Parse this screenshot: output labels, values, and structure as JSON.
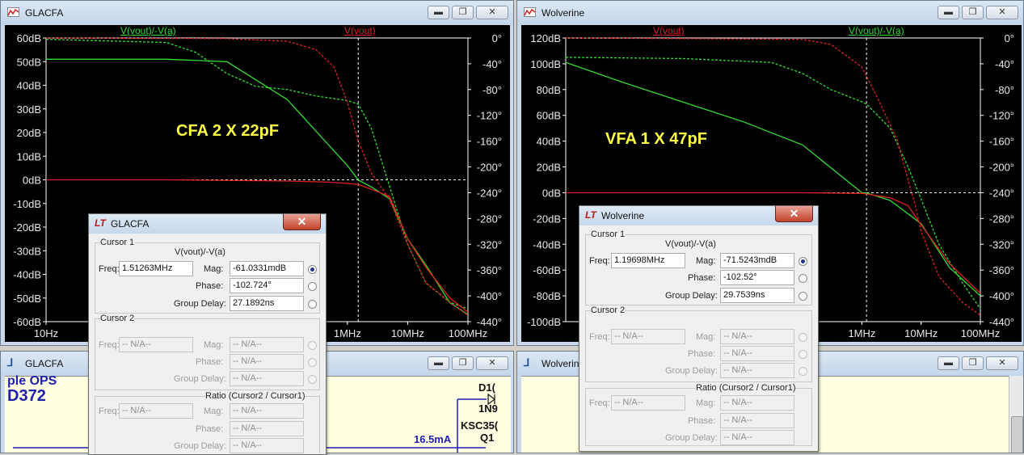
{
  "plots": [
    {
      "window_title": "GLACFA",
      "annotation": "CFA 2 X 22pF",
      "legend": {
        "green": "V(vout)/-V(a)",
        "red": "V(vout)"
      },
      "left_ticks": [
        "60dB",
        "50dB",
        "40dB",
        "30dB",
        "20dB",
        "10dB",
        "0dB",
        "-10dB",
        "-20dB",
        "-30dB",
        "-40dB",
        "-50dB",
        "-60dB"
      ],
      "right_ticks": [
        "0°",
        "-40°",
        "-80°",
        "-120°",
        "-160°",
        "-200°",
        "-240°",
        "-280°",
        "-320°",
        "-360°",
        "-400°",
        "-440°"
      ],
      "x_ticks_visible": [
        "10Hz",
        "1MHz",
        "10MHz",
        "100MHz"
      ],
      "chart_data": {
        "type": "line",
        "title": "",
        "xlabel": "",
        "ylabel": "",
        "x_scale": "log",
        "xlim": [
          "10Hz",
          "100MHz"
        ],
        "ylim_left_dB": [
          -60,
          60
        ],
        "ylim_right_deg": [
          -440,
          0
        ],
        "cursor_x": "1.51263MHz",
        "series": [
          {
            "name": "V(vout)/-V(a)",
            "trace": "magnitude",
            "color": "#33dd33",
            "x": [
              10,
              1000,
              10000,
              100000,
              1000000,
              1512630,
              2500000,
              5000000,
              10000000,
              20000000,
              50000000,
              100000000
            ],
            "y_dB": [
              51,
              51,
              50,
              34,
              6,
              -0.06,
              -3,
              -8,
              -25,
              -36,
              -52,
              -57
            ]
          },
          {
            "name": "V(vout)/-V(a)",
            "trace": "phase",
            "color": "#33dd33",
            "x": [
              10,
              1000,
              3000,
              10000,
              30000,
              100000,
              300000,
              1000000,
              1512630,
              2500000,
              5000000,
              10000000,
              20000000,
              50000000,
              100000000
            ],
            "y_deg": [
              -2,
              -7,
              -22,
              -55,
              -75,
              -80,
              -90,
              -97,
              -102.7,
              -140,
              -230,
              -320,
              -380,
              -410,
              -420
            ]
          },
          {
            "name": "V(vout)",
            "trace": "magnitude",
            "color": "#e02020",
            "x": [
              10,
              1000,
              100000,
              500000,
              1000000,
              1512630,
              2500000,
              5000000,
              10000000,
              20000000,
              50000000,
              100000000
            ],
            "y_dB": [
              0,
              0,
              -0.5,
              -1,
              -1.5,
              -2,
              -4,
              -7,
              -25,
              -37,
              -50,
              -56
            ]
          },
          {
            "name": "V(vout)",
            "trace": "phase",
            "color": "#e02020",
            "x": [
              10,
              10000,
              100000,
              300000,
              600000,
              1000000,
              1512630,
              2500000,
              5000000,
              10000000,
              20000000,
              50000000,
              100000000
            ],
            "y_deg": [
              0,
              -1,
              -5,
              -18,
              -45,
              -100,
              -160,
              -210,
              -250,
              -320,
              -380,
              -410,
              -430
            ]
          }
        ]
      }
    },
    {
      "window_title": "Wolverine",
      "annotation": "VFA 1 X 47pF",
      "legend": {
        "green": "V(vout)/-V(a)",
        "red": "V(vout)"
      },
      "left_ticks": [
        "120dB",
        "100dB",
        "80dB",
        "60dB",
        "40dB",
        "20dB",
        "0dB",
        "-20dB",
        "-40dB",
        "-60dB",
        "-80dB",
        "-100dB"
      ],
      "right_ticks": [
        "0°",
        "-40°",
        "-80°",
        "-120°",
        "-160°",
        "-200°",
        "-240°",
        "-280°",
        "-320°",
        "-360°",
        "-400°",
        "-440°"
      ],
      "x_ticks_visible": [
        "1MHz",
        "10MHz",
        "100MHz"
      ],
      "chart_data": {
        "type": "line",
        "title": "",
        "xlabel": "",
        "ylabel": "",
        "x_scale": "log",
        "xlim": [
          "10Hz",
          "100MHz"
        ],
        "ylim_left_dB": [
          -100,
          120
        ],
        "ylim_right_deg": [
          -440,
          0
        ],
        "cursor_x": "1.19698MHz",
        "series": [
          {
            "name": "V(vout)/-V(a)",
            "trace": "magnitude",
            "color": "#33dd33",
            "x": [
              10,
              100,
              1000,
              10000,
              100000,
              1000000,
              1196980,
              3000000,
              10000000,
              30000000,
              100000000
            ],
            "y_dB": [
              101,
              85,
              70,
              55,
              37,
              0,
              -0.07,
              -6,
              -24,
              -58,
              -80
            ]
          },
          {
            "name": "V(vout)/-V(a)",
            "trace": "phase",
            "color": "#33dd33",
            "x": [
              10,
              1000,
              30000,
              100000,
              300000,
              1000000,
              1196980,
              3000000,
              6000000,
              10000000,
              20000000,
              50000000,
              100000000
            ],
            "y_deg": [
              -30,
              -32,
              -38,
              -55,
              -80,
              -99,
              -102.5,
              -140,
              -200,
              -250,
              -320,
              -380,
              -420
            ]
          },
          {
            "name": "V(vout)",
            "trace": "magnitude",
            "color": "#e02020",
            "x": [
              10,
              1000,
              100000,
              1000000,
              1196980,
              3000000,
              6000000,
              10000000,
              30000000,
              100000000
            ],
            "y_dB": [
              0,
              0,
              0,
              -0.5,
              -1,
              -4,
              -10,
              -25,
              -55,
              -78
            ]
          },
          {
            "name": "V(vout)",
            "trace": "phase",
            "color": "#e02020",
            "x": [
              10,
              100000,
              300000,
              1000000,
              2000000,
              4000000,
              6000000,
              8000000,
              10000000,
              20000000,
              50000000,
              100000000
            ],
            "y_deg": [
              0,
              -2,
              -10,
              -45,
              -100,
              -160,
              -220,
              -260,
              -300,
              -370,
              -410,
              -430
            ]
          }
        ]
      }
    }
  ],
  "schematics": [
    {
      "window_title": "GLACFA",
      "texts": [
        "ple OPS",
        "D372",
        "D1(",
        "1N9",
        "KSC35(",
        "16.5mA",
        "Q1"
      ]
    },
    {
      "window_title": "Wolverine"
    }
  ],
  "dialogs": [
    {
      "title": "GLACFA",
      "close": "✕",
      "cursor1": {
        "label": "Cursor 1",
        "expr": "V(vout)/-V(a)",
        "freq_label": "Freq:",
        "freq": "1.51263MHz",
        "mag_label": "Mag:",
        "mag": "-61.0331mdB",
        "phase_label": "Phase:",
        "phase": "-102.724°",
        "gd_label": "Group Delay:",
        "gd": "27.1892ns"
      },
      "cursor2": {
        "label": "Cursor 2",
        "freq_label": "Freq:",
        "freq": "-- N/A--",
        "mag_label": "Mag:",
        "mag": "-- N/A--",
        "phase_label": "Phase:",
        "phase": "-- N/A--",
        "gd_label": "Group Delay:",
        "gd": "-- N/A--"
      },
      "ratio": {
        "label": "Ratio (Cursor2 / Cursor1)",
        "freq_label": "Freq:",
        "freq": "-- N/A--",
        "mag_label": "Mag:",
        "mag": "-- N/A--",
        "phase_label": "Phase:",
        "phase": "-- N/A--",
        "gd_label": "Group Delay:",
        "gd": "-- N/A--"
      }
    },
    {
      "title": "Wolverine",
      "close": "✕",
      "cursor1": {
        "label": "Cursor 1",
        "expr": "V(vout)/-V(a)",
        "freq_label": "Freq:",
        "freq": "1.19698MHz",
        "mag_label": "Mag:",
        "mag": "-71.5243mdB",
        "phase_label": "Phase:",
        "phase": "-102.52°",
        "gd_label": "Group Delay:",
        "gd": "29.7539ns"
      },
      "cursor2": {
        "label": "Cursor 2",
        "freq_label": "Freq:",
        "freq": "-- N/A--",
        "mag_label": "Mag:",
        "mag": "-- N/A--",
        "phase_label": "Phase:",
        "phase": "-- N/A--",
        "gd_label": "Group Delay:",
        "gd": "-- N/A--"
      },
      "ratio": {
        "label": "Ratio (Cursor2 / Cursor1)",
        "freq_label": "Freq:",
        "freq": "-- N/A--",
        "mag_label": "Mag:",
        "mag": "-- N/A--",
        "phase_label": "Phase:",
        "phase": "-- N/A--",
        "gd_label": "Group Delay:",
        "gd": "-- N/A--"
      }
    }
  ],
  "colors": {
    "green": "#33dd33",
    "red": "#e02020",
    "annotation": "#ffff44",
    "grid": "#ffffff",
    "plot_bg": "#000000",
    "schematic_bg": "#ffffe1"
  }
}
